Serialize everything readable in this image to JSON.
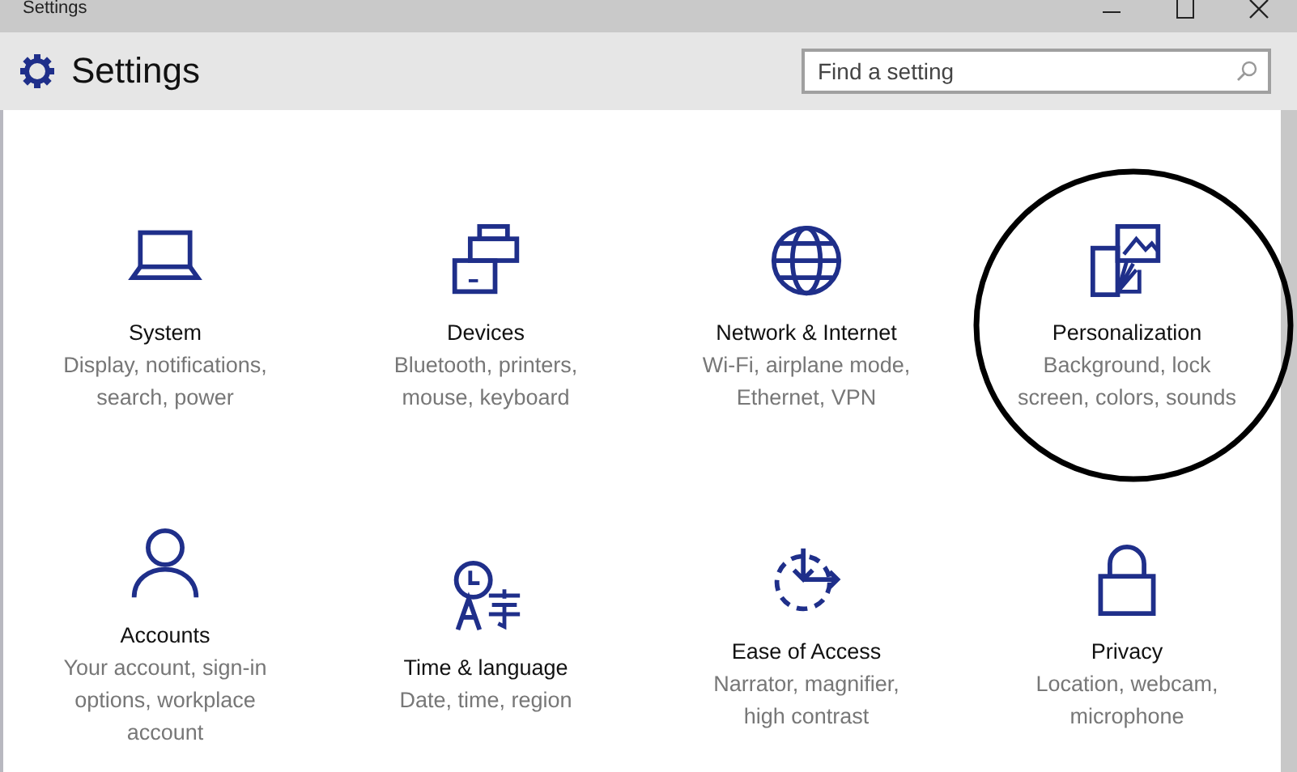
{
  "window": {
    "title": "Settings"
  },
  "header": {
    "title": "Settings",
    "search": {
      "placeholder": "Find a setting"
    }
  },
  "tiles": [
    {
      "title": "System",
      "description": "Display, notifications, search, power"
    },
    {
      "title": "Devices",
      "description": "Bluetooth, printers, mouse, keyboard"
    },
    {
      "title": "Network & Internet",
      "description": "Wi-Fi, airplane mode, Ethernet, VPN"
    },
    {
      "title": "Personalization",
      "description": "Background, lock screen, colors, sounds",
      "circled": true
    },
    {
      "title": "Accounts",
      "description": "Your account, sign-in options, workplace account"
    },
    {
      "title": "Time & language",
      "description": "Date, time, region"
    },
    {
      "title": "Ease of Access",
      "description": "Narrator, magnifier, high contrast"
    },
    {
      "title": "Privacy",
      "description": "Location, webcam, microphone"
    }
  ]
}
